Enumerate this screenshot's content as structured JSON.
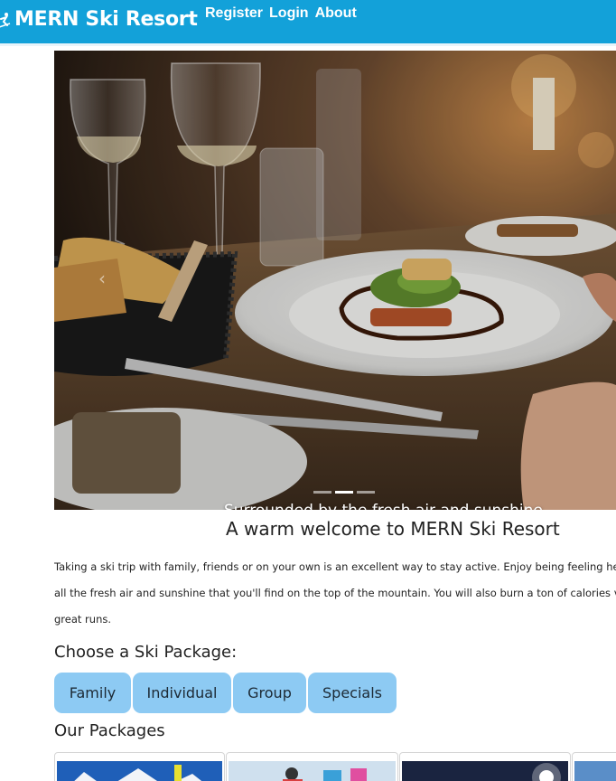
{
  "header": {
    "brand": "MERN Ski Resort",
    "nav": [
      "Register",
      "Login",
      "About"
    ]
  },
  "carousel": {
    "caption": "Surrounded by the fresh air and sunshine",
    "slides": 3,
    "active_slide": 1,
    "prev_icon": "chevron-left-icon"
  },
  "welcome": {
    "title": "A warm welcome to MERN Ski Resort",
    "lines": [
      "Taking a ski trip with family, friends or on your own is an excellent way to stay active. Enjoy being feeling he",
      "all the fresh air and sunshine that you'll find on the top of the mountain. You will also burn a ton of calories v",
      "great runs."
    ]
  },
  "packages": {
    "heading": "Choose a Ski Package:",
    "buttons": [
      "Family",
      "Individual",
      "Group",
      "Specials"
    ],
    "our_heading": "Our Packages"
  },
  "colors": {
    "header_bg": "#13a1d9",
    "button_bg": "#8dcaf3"
  }
}
